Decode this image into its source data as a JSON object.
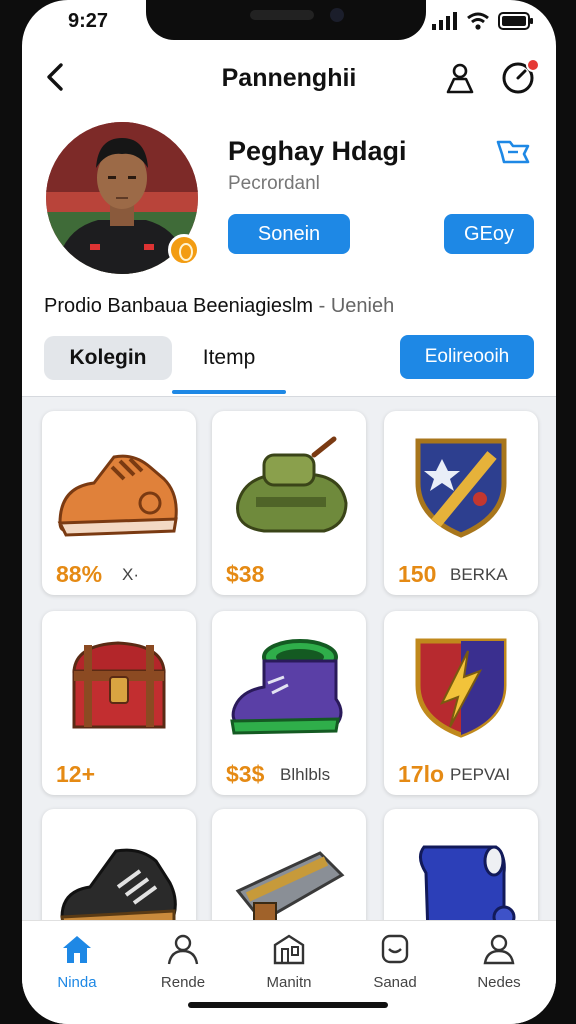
{
  "status": {
    "time": "9:27"
  },
  "header": {
    "title": "Pannenghii"
  },
  "profile": {
    "name": "Peghay Hdagi",
    "subtitle": "Pecrordanl",
    "sort_label": "Sonein",
    "get_label": "GEoy"
  },
  "bio": {
    "main": "Prodio Banbaua Beeniagieslm",
    "extra": " - Uenieh"
  },
  "tabs": {
    "active": "Kolegin",
    "second": "Itemp",
    "follow_label": "Eolireooih"
  },
  "items": [
    {
      "price": "88%",
      "tag": "X·"
    },
    {
      "price": "$38",
      "tag": ""
    },
    {
      "price": "150",
      "tag": "BERKA"
    },
    {
      "price": "12+",
      "tag": ""
    },
    {
      "price": "$3$",
      "tag": "Blhlbls"
    },
    {
      "price": "17lo",
      "tag": "PEPVAI"
    },
    {
      "price": "",
      "tag": ""
    },
    {
      "price": "",
      "tag": ""
    },
    {
      "price": "",
      "tag": ""
    }
  ],
  "nav": [
    {
      "label": "Ninda",
      "icon": "home-icon",
      "active": true
    },
    {
      "label": "Rende",
      "icon": "person-icon"
    },
    {
      "label": "Manitn",
      "icon": "store-icon"
    },
    {
      "label": "Sanad",
      "icon": "shield-icon"
    },
    {
      "label": "Nedes",
      "icon": "profile-icon"
    }
  ],
  "colors": {
    "accent": "#1e88e5",
    "price": "#e58a14",
    "badge": "#f39c12",
    "notification": "#e53935"
  }
}
